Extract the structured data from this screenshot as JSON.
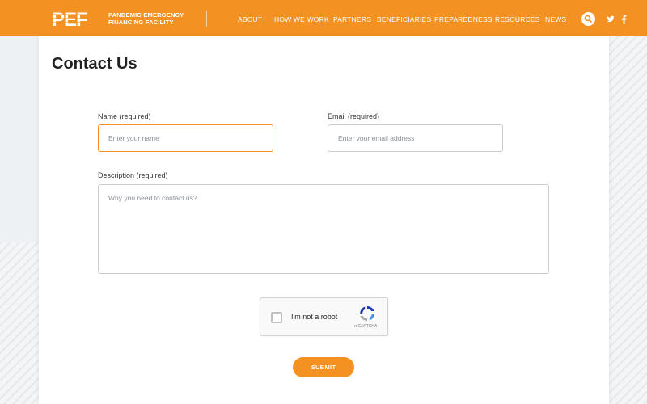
{
  "header": {
    "logo_text": "PEF",
    "org_name_line1": "PANDEMIC EMERGENCY",
    "org_name_line2": "FINANCING FACILITY",
    "nav": [
      "ABOUT",
      "HOW WE WORK",
      "PARTNERS",
      "BENEFICIARIES",
      "PREPAREDNESS",
      "RESOURCES",
      "NEWS"
    ],
    "icons": [
      "search-icon",
      "twitter-icon",
      "facebook-icon"
    ],
    "brand_color": "#f39122"
  },
  "page": {
    "title": "Contact Us"
  },
  "form": {
    "name_label": "Name (required)",
    "name_placeholder": "Enter your name",
    "email_label": "Email (required)",
    "email_placeholder": "Enter your email address",
    "description_label": "Description (required)",
    "description_placeholder": "Why you need to contact us?",
    "captcha_text": "I'm not a robot",
    "captcha_brand": "reCAPTCHA",
    "submit_label": "SUBMIT"
  }
}
